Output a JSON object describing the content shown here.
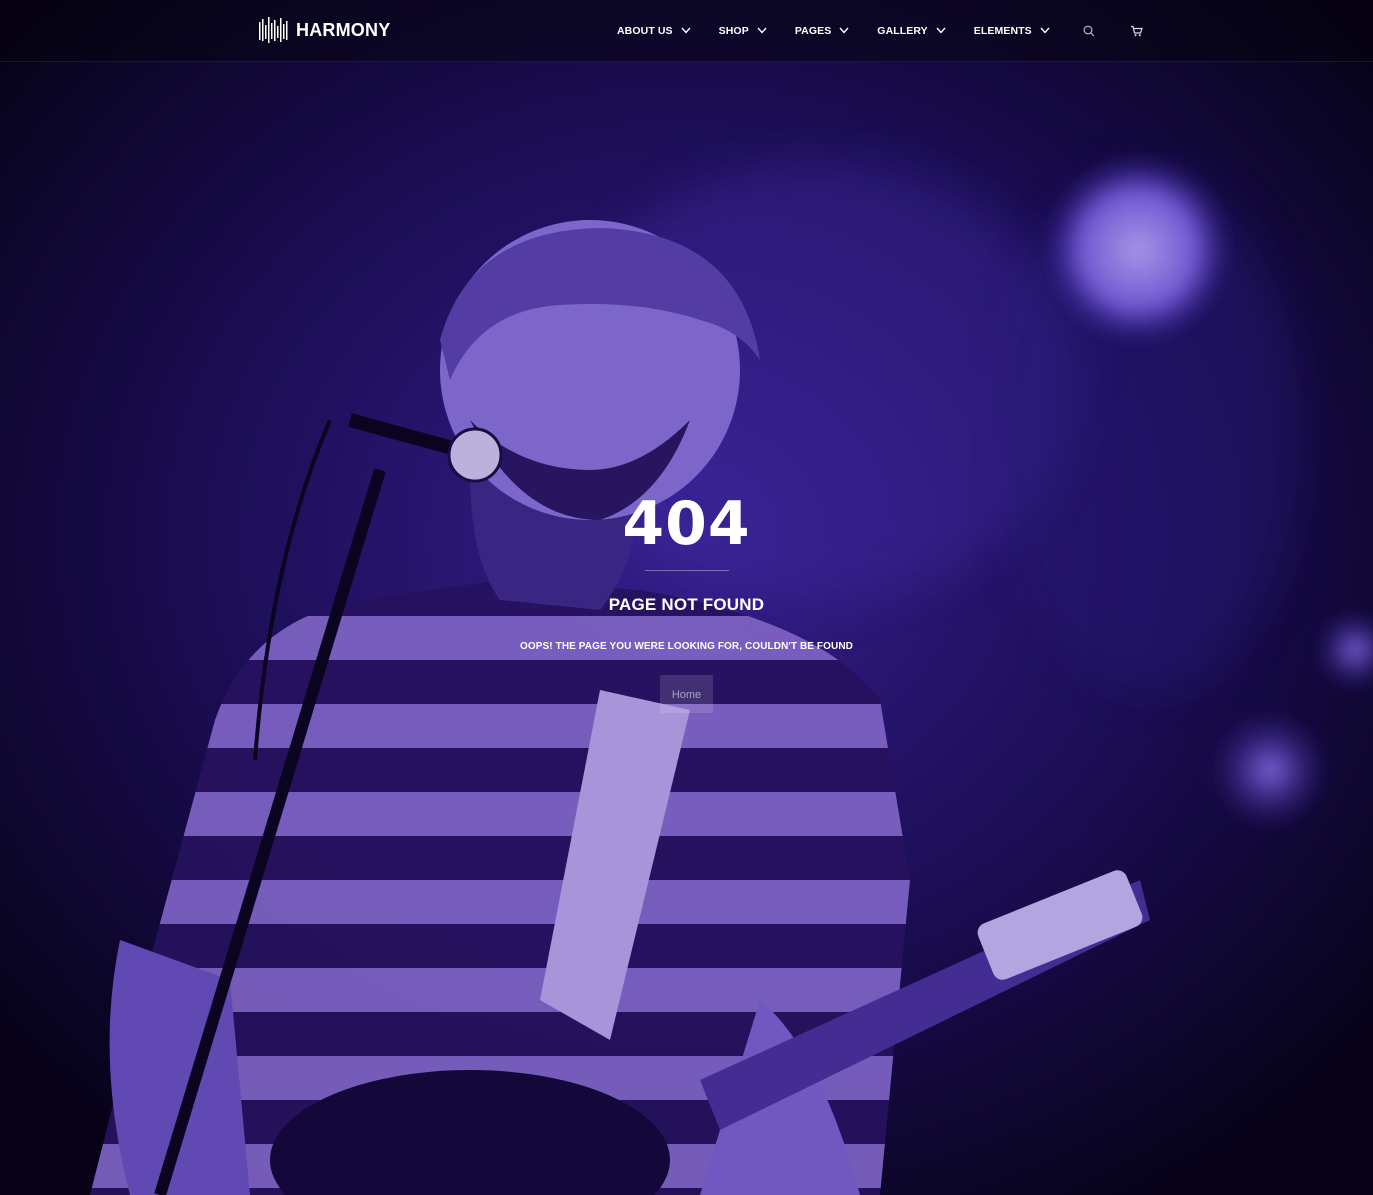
{
  "brand": {
    "name": "HARMONY"
  },
  "nav": {
    "items": [
      {
        "label": "ABOUT US"
      },
      {
        "label": "SHOP"
      },
      {
        "label": "PAGES"
      },
      {
        "label": "GALLERY"
      },
      {
        "label": "ELEMENTS"
      }
    ],
    "search_icon": "search-icon",
    "cart_icon": "cart-icon"
  },
  "error": {
    "code": "404",
    "title": "PAGE NOT FOUND",
    "message": "OOPS! THE PAGE YOU WERE LOOKING FOR, COULDN'T BE FOUND",
    "button_label": "Home"
  },
  "colors": {
    "hero_tint": "#3a20a8",
    "text": "#ffffff"
  }
}
